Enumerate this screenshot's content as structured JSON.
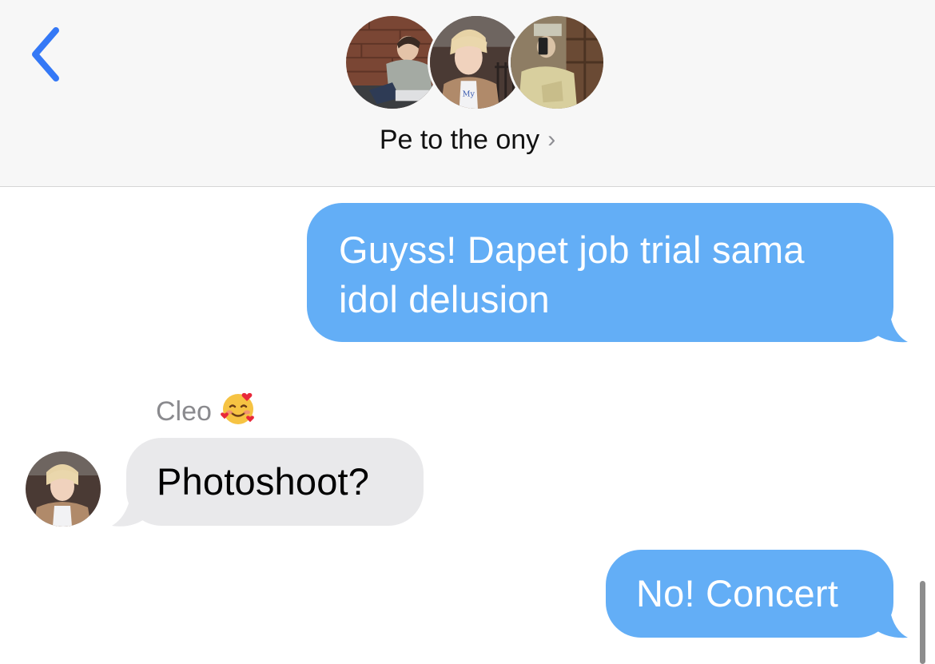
{
  "header": {
    "back_icon": "chevron-left-icon",
    "group_name": "Pe to the ony",
    "group_chevron": "›",
    "accent_color": "#3478f6",
    "avatars": [
      "avatar-photo-1",
      "avatar-photo-2",
      "avatar-photo-3"
    ]
  },
  "messages": [
    {
      "direction": "outgoing",
      "text": "Guyss! Dapet job trial sama idol delusion",
      "color": "#63aef6"
    },
    {
      "direction": "incoming",
      "sender": "Cleo",
      "sender_emoji": "smiling-face-with-hearts-emoji",
      "text": "Photoshoot?",
      "color": "#e9e9eb"
    },
    {
      "direction": "outgoing",
      "text": "No! Concert",
      "color": "#63aef6"
    }
  ]
}
